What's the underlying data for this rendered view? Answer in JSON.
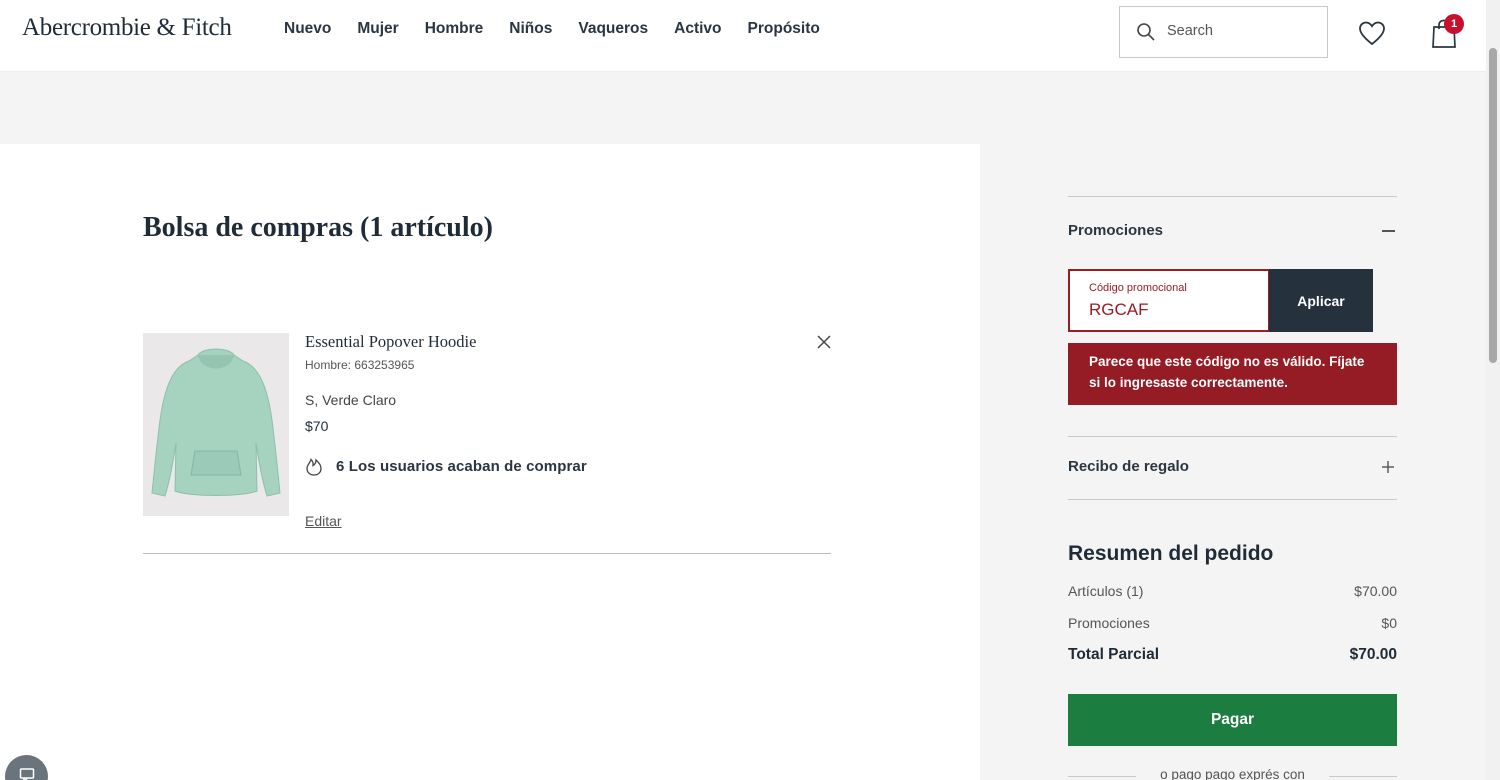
{
  "header": {
    "logo": "Abercrombie & Fitch",
    "nav": [
      "Nuevo",
      "Mujer",
      "Hombre",
      "Niños",
      "Vaqueros",
      "Activo",
      "Propósito"
    ],
    "search_placeholder": "Search",
    "bag_count": "1"
  },
  "cart": {
    "title": "Bolsa de compras (1 artículo)",
    "item": {
      "name": "Essential Popover Hoodie",
      "sku": "Hombre: 663253965",
      "variant": "S, Verde Claro",
      "price": "$70",
      "recent_buyers": "6 Los usuarios acaban de comprar",
      "edit_label": "Editar"
    }
  },
  "sidebar": {
    "promo_heading": "Promociones",
    "promo_label": "Código promocional",
    "promo_value": "RGCAF",
    "apply_label": "Aplicar",
    "error_message": "Parece que este código no es válido. Fíjate si lo ingresaste correctamente.",
    "gift_heading": "Recibo de regalo",
    "summary": {
      "title": "Resumen del pedido",
      "rows": [
        {
          "label": "Artículos (1)",
          "value": "$70.00"
        },
        {
          "label": "Promociones",
          "value": "$0"
        },
        {
          "label": "Total Parcial",
          "value": "$70.00"
        }
      ]
    },
    "pay_label": "Pagar",
    "express_text": "o pago pago exprés con"
  },
  "colors": {
    "pay_button": "#1b7d40",
    "apply_button": "#25323e",
    "error_background": "#951b24",
    "badge": "#c8102e"
  }
}
